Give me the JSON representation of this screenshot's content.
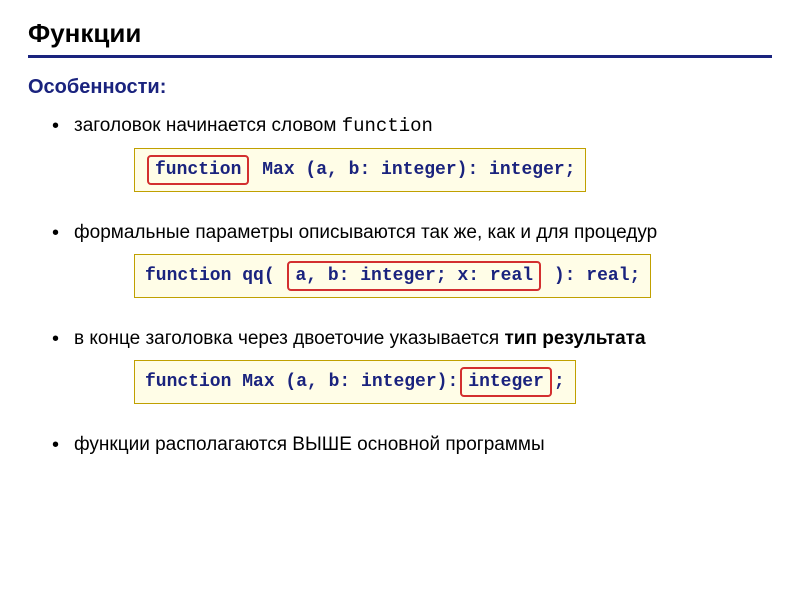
{
  "title": "Функции",
  "subtitle": "Особенности:",
  "bullets": {
    "b1_pre": "заголовок начинается словом ",
    "b1_code": "function",
    "b2": "формальные параметры описываются так же, как и для процедур",
    "b3_pre": "в конце заголовка через двоеточие указывается ",
    "b3_bold": "тип результата",
    "b4": "функции располагаются ВЫШЕ основной программы"
  },
  "code1": {
    "hl": "function",
    "rest": " Max (a, b: integer): integer;"
  },
  "code2": {
    "pre": "function qq( ",
    "hl": "a, b: integer; x: real",
    "post": " ): real;"
  },
  "code3": {
    "pre": "function Max (a, b: integer):",
    "hl": "integer",
    "post": ";"
  }
}
